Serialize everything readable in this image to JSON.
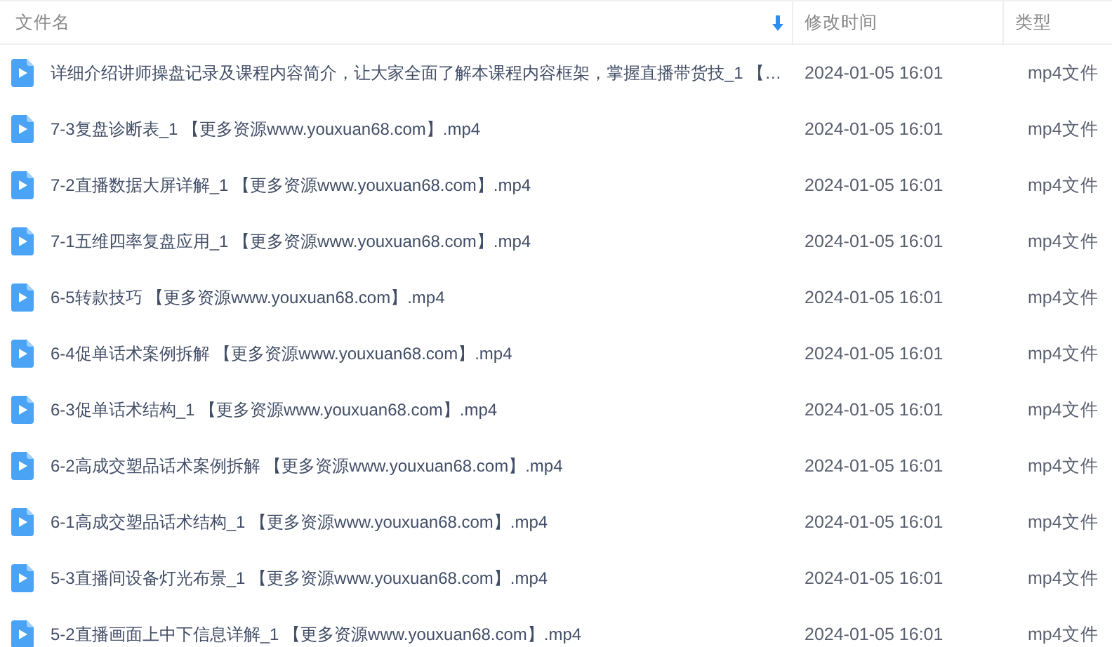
{
  "table": {
    "columns": [
      {
        "label": "文件名",
        "sorted_descending": true
      },
      {
        "label": "修改时间",
        "sorted_descending": false
      },
      {
        "label": "类型",
        "sorted_descending": false
      }
    ],
    "rows": [
      {
        "name": "详细介绍讲师操盘记录及课程内容简介，让大家全面了解本课程内容框架，掌握直播带货技_1 【…",
        "modified": "2024-01-05 16:01",
        "type": "mp4文件"
      },
      {
        "name": "7-3复盘诊断表_1 【更多资源www.youxuan68.com】.mp4",
        "modified": "2024-01-05 16:01",
        "type": "mp4文件"
      },
      {
        "name": "7-2直播数据大屏详解_1 【更多资源www.youxuan68.com】.mp4",
        "modified": "2024-01-05 16:01",
        "type": "mp4文件"
      },
      {
        "name": "7-1五维四率复盘应用_1 【更多资源www.youxuan68.com】.mp4",
        "modified": "2024-01-05 16:01",
        "type": "mp4文件"
      },
      {
        "name": "6-5转款技巧 【更多资源www.youxuan68.com】.mp4",
        "modified": "2024-01-05 16:01",
        "type": "mp4文件"
      },
      {
        "name": "6-4促单话术案例拆解 【更多资源www.youxuan68.com】.mp4",
        "modified": "2024-01-05 16:01",
        "type": "mp4文件"
      },
      {
        "name": "6-3促单话术结构_1 【更多资源www.youxuan68.com】.mp4",
        "modified": "2024-01-05 16:01",
        "type": "mp4文件"
      },
      {
        "name": "6-2高成交塑品话术案例拆解 【更多资源www.youxuan68.com】.mp4",
        "modified": "2024-01-05 16:01",
        "type": "mp4文件"
      },
      {
        "name": "6-1高成交塑品话术结构_1 【更多资源www.youxuan68.com】.mp4",
        "modified": "2024-01-05 16:01",
        "type": "mp4文件"
      },
      {
        "name": "5-3直播间设备灯光布景_1 【更多资源www.youxuan68.com】.mp4",
        "modified": "2024-01-05 16:01",
        "type": "mp4文件"
      },
      {
        "name": "5-2直播画面上中下信息详解_1 【更多资源www.youxuan68.com】.mp4",
        "modified": "2024-01-05 16:01",
        "type": "mp4文件"
      }
    ]
  }
}
